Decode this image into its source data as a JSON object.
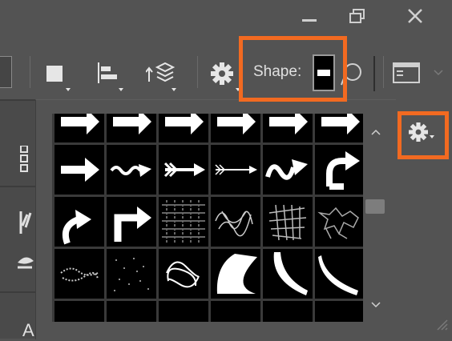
{
  "window": {
    "minimize_icon": "minimize-icon",
    "restore_icon": "restore-icon",
    "close_icon": "close-icon"
  },
  "options_bar": {
    "shape_label": "Shape:",
    "tools": [
      "fill-icon",
      "align-icon",
      "arrange-layers-icon",
      "gear-icon",
      "shape-picker",
      "ellipse-stroke-icon",
      "panel-icon"
    ]
  },
  "shape_picker": {
    "rows": [
      [
        "arrow-shape",
        "arrow-shape",
        "arrow-shape",
        "arrow-shape",
        "arrow-shape",
        "arrow-shape"
      ],
      [
        "arrow-right",
        "arrow-wavy",
        "arrow-feathered",
        "arrow-feathered-thin",
        "arrow-squiggle",
        "arrow-u-turn"
      ],
      [
        "arrow-curved-up-right",
        "arrow-bent-up-right",
        "texture-grid",
        "texture-scribble",
        "texture-net",
        "texture-crackle"
      ],
      [
        "texture-dust",
        "texture-specks",
        "texture-knot",
        "shape-crescent-left",
        "shape-curve-sweep",
        "shape-curve-stroke"
      ],
      [
        "frame-banner",
        "frame-banner",
        "frame-banner",
        "frame-banner",
        "frame-banner",
        "frame-banner"
      ]
    ]
  },
  "colors": {
    "highlight": "#f26a21",
    "background": "#535353",
    "swatch_bg": "#000000"
  }
}
